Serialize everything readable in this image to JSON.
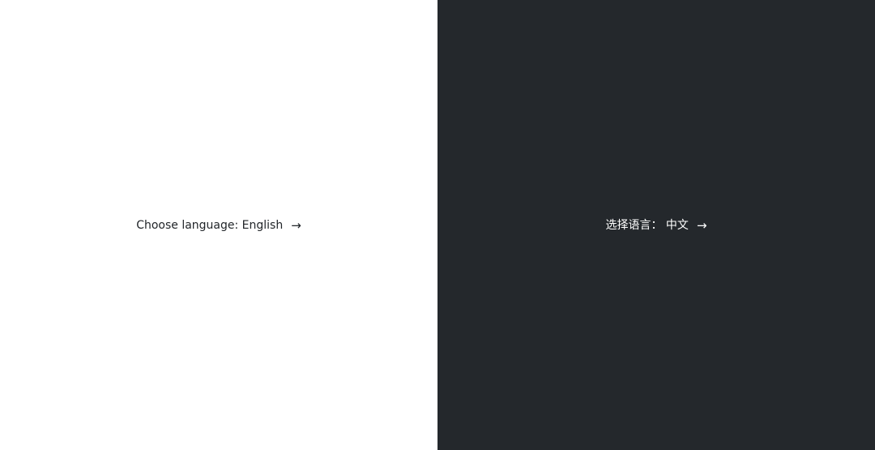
{
  "left": {
    "label": "Choose language: English",
    "arrow": "→",
    "background": "#ffffff",
    "text_color": "#212529"
  },
  "right": {
    "label": "选择语言： 中文",
    "arrow": "→",
    "background": "#24282c",
    "text_color": "#ffffff"
  },
  "icons": {
    "left_arrow": "arrow-right-icon",
    "right_arrow": "arrow-right-icon"
  }
}
